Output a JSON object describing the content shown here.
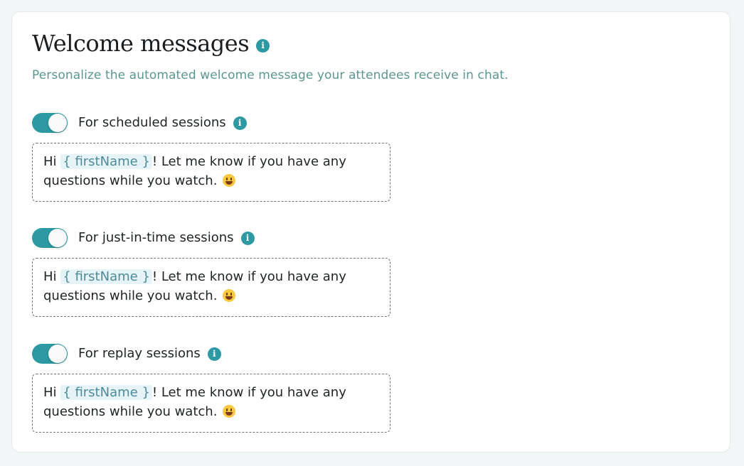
{
  "header": {
    "title": "Welcome messages",
    "subtitle": "Personalize the automated welcome message your attendees receive in chat."
  },
  "info_icon_glyph": "i",
  "sections": [
    {
      "label": "For scheduled sessions",
      "enabled": true,
      "message": {
        "before_token": "Hi ",
        "token": "{ firstName }",
        "after_token": "! Let me know if you have any questions while you watch."
      }
    },
    {
      "label": "For just-in-time sessions",
      "enabled": true,
      "message": {
        "before_token": "Hi ",
        "token": "{ firstName }",
        "after_token": "! Let me know if you have any questions while you watch."
      }
    },
    {
      "label": "For replay sessions",
      "enabled": true,
      "message": {
        "before_token": "Hi ",
        "token": "{ firstName }",
        "after_token": "! Let me know if you have any questions while you watch."
      }
    }
  ],
  "icons": {
    "info": "info-icon",
    "emoji": "grinning-face-emoji"
  },
  "colors": {
    "accent": "#2d9aa3",
    "subtitle": "#5b9690",
    "token_bg": "#e6f3f7",
    "token_text": "#4d8b9b",
    "page_bg": "#f2f6f6"
  }
}
